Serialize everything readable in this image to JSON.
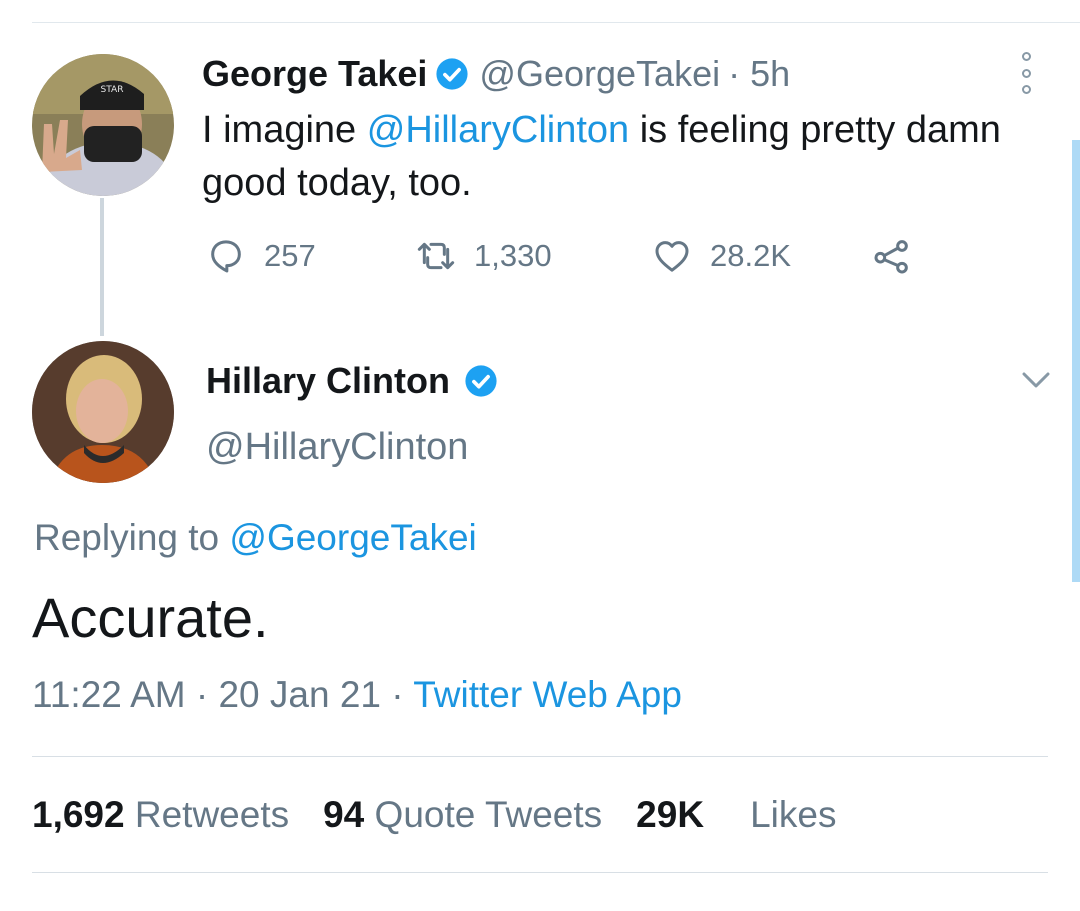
{
  "colors": {
    "link": "#1b95e0",
    "muted": "#657786",
    "verified": "#1da1f2"
  },
  "parent_tweet": {
    "author_name": "George Takei",
    "author_handle": "@GeorgeTakei",
    "time_ago": "· 5h",
    "text_before": "I imagine ",
    "text_mention": "@HillaryClinton",
    "text_after": " is feeling pretty damn good today, too.",
    "replies": "257",
    "retweets": "1,330",
    "likes": "28.2K",
    "icons": [
      "reply-icon",
      "retweet-icon",
      "like-icon",
      "share-icon",
      "more-options-icon"
    ]
  },
  "main_tweet": {
    "author_name": "Hillary Clinton",
    "author_handle": "@HillaryClinton",
    "replying_label": "Replying to ",
    "replying_handle": "@GeorgeTakei",
    "text": "Accurate.",
    "timestamp": "11:22 AM · 20 Jan 21 · ",
    "source": "Twitter Web App",
    "retweets_count": "1,692",
    "retweets_label": "Retweets",
    "quotes_count": "94",
    "quotes_label": "Quote Tweets",
    "likes_count": "29K",
    "likes_label": "Likes"
  }
}
